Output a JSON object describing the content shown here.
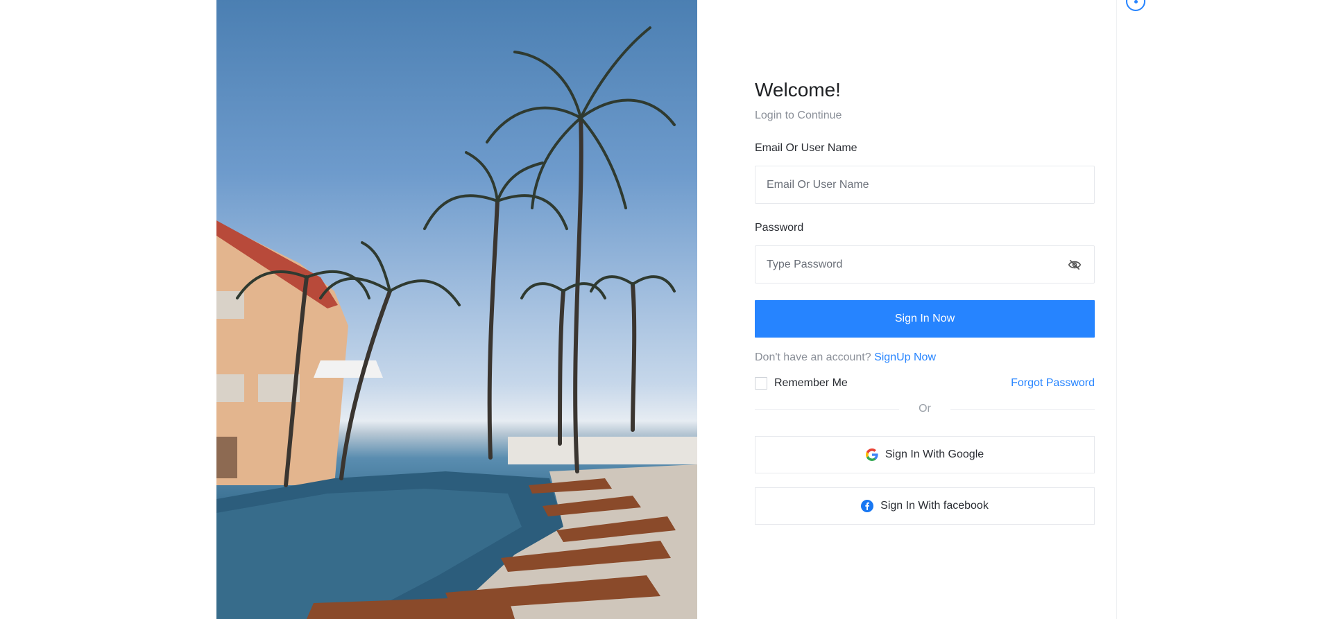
{
  "login": {
    "title": "Welcome!",
    "subtitle": "Login to Continue",
    "email_label": "Email Or User Name",
    "email_placeholder": "Email Or User Name",
    "password_label": "Password",
    "password_placeholder": "Type Password",
    "signin_label": "Sign In Now",
    "no_account_text": "Don't have an account?",
    "signup_link": "SignUp Now",
    "remember_label": "Remember Me",
    "forgot_link": "Forgot Password",
    "or_text": "Or",
    "google_label": "Sign In With Google",
    "facebook_label": "Sign In With facebook"
  },
  "colors": {
    "accent": "#2684ff",
    "muted_text": "#8a8f98",
    "border": "#e7e9ed"
  },
  "icons": {
    "password_toggle": "eye-slash-icon",
    "google": "google-icon",
    "facebook": "facebook-icon",
    "settings": "settings-dot-icon"
  }
}
